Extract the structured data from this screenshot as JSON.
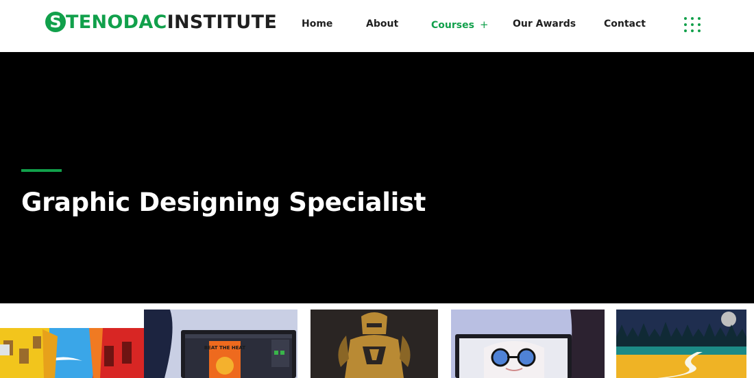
{
  "header": {
    "logo": {
      "s_letter": "S",
      "part1": "TENODAC",
      "part2": "INSTITUTE"
    },
    "nav": [
      {
        "label": "Home"
      },
      {
        "label": "About"
      },
      {
        "label": "Courses",
        "plus": "+"
      },
      {
        "label": "Our Awards"
      },
      {
        "label": "Contact"
      }
    ],
    "menu_icon": "grid-dots-icon"
  },
  "hero": {
    "title": "Graphic Designing Specialist"
  },
  "gallery": {
    "poster_text": "BEAT THE HEAT",
    "items": [
      "colorful-street-illustration",
      "laptop-poster-design",
      "golden-warrior-artwork",
      "laptop-anime-portrait",
      "night-landscape-illustration"
    ]
  },
  "colors": {
    "accent": "#11a04b",
    "text": "#1f1f1f",
    "hero_bg": "#000000"
  }
}
